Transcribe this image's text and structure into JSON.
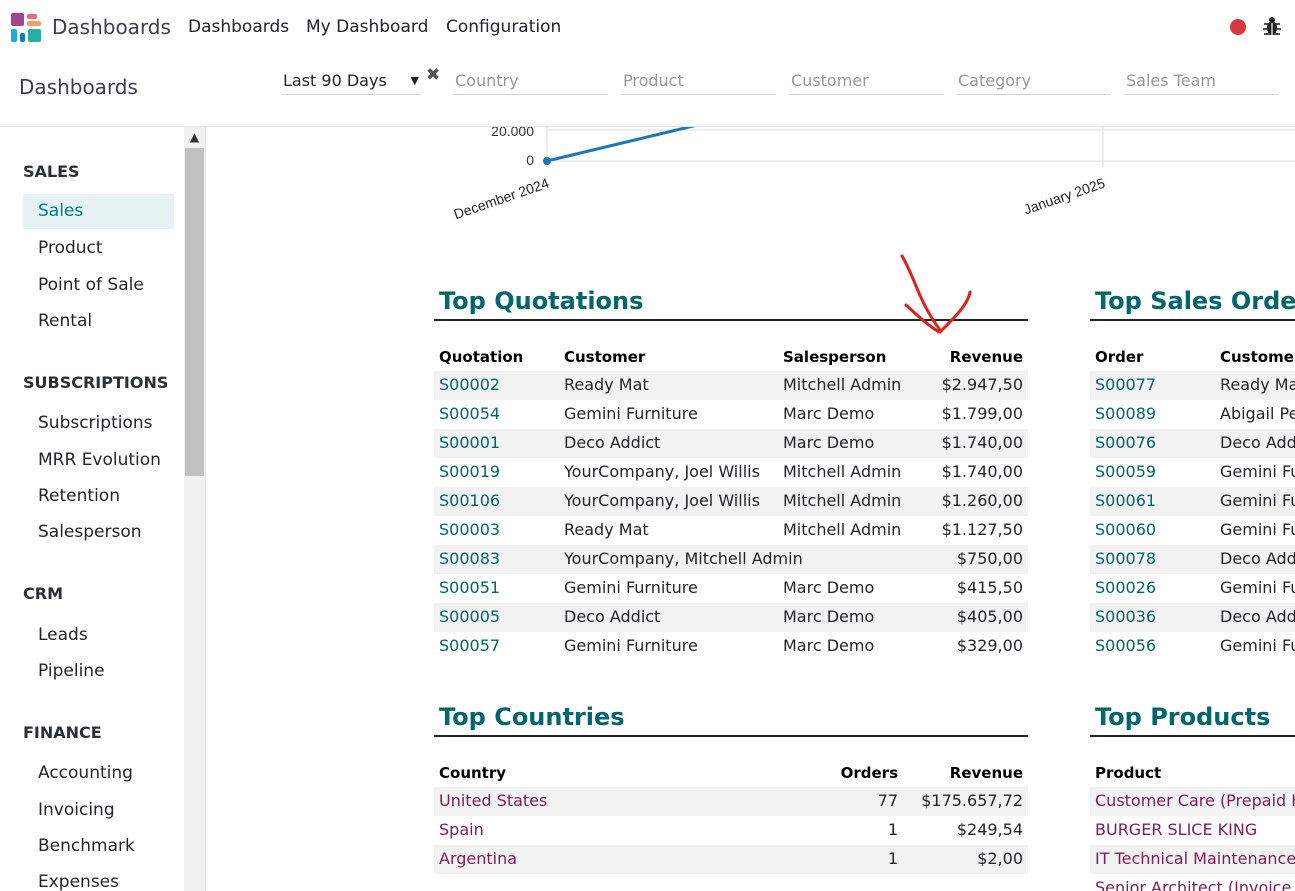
{
  "navbar": {
    "app_name": "Dashboards",
    "menu": [
      "Dashboards",
      "My Dashboard",
      "Configuration"
    ]
  },
  "control_panel": {
    "title": "Dashboards",
    "date_filter": "Last 90 Days",
    "filters": [
      "Country",
      "Product",
      "Customer",
      "Category",
      "Sales Team"
    ]
  },
  "sidebar": {
    "sections": [
      {
        "title": "SALES",
        "items": [
          "Sales",
          "Product",
          "Point of Sale",
          "Rental"
        ]
      },
      {
        "title": "SUBSCRIPTIONS",
        "items": [
          "Subscriptions",
          "MRR Evolution",
          "Retention",
          "Salesperson"
        ]
      },
      {
        "title": "CRM",
        "items": [
          "Leads",
          "Pipeline"
        ]
      },
      {
        "title": "FINANCE",
        "items": [
          "Accounting",
          "Invoicing",
          "Benchmark",
          "Expenses"
        ]
      }
    ],
    "active": "Sales"
  },
  "chart_data": {
    "type": "line",
    "x_ticks": [
      "December 2024",
      "January 2025"
    ],
    "y_ticks": [
      "20.000",
      "0"
    ],
    "points": [
      {
        "x": "December 2024",
        "y": 0
      }
    ],
    "color": "#1f77b4"
  },
  "top_quotations": {
    "title": "Top Quotations",
    "columns": [
      "Quotation",
      "Customer",
      "Salesperson",
      "Revenue"
    ],
    "rows": [
      [
        "S00002",
        "Ready Mat",
        "Mitchell Admin",
        "$2.947,50"
      ],
      [
        "S00054",
        "Gemini Furniture",
        "Marc Demo",
        "$1.799,00"
      ],
      [
        "S00001",
        "Deco Addict",
        "Marc Demo",
        "$1.740,00"
      ],
      [
        "S00019",
        "YourCompany, Joel Willis",
        "Mitchell Admin",
        "$1.740,00"
      ],
      [
        "S00106",
        "YourCompany, Joel Willis",
        "Mitchell Admin",
        "$1.260,00"
      ],
      [
        "S00003",
        "Ready Mat",
        "Mitchell Admin",
        "$1.127,50"
      ],
      [
        "S00083",
        "YourCompany, Mitchell Admin",
        "",
        "$750,00"
      ],
      [
        "S00051",
        "Gemini Furniture",
        "Marc Demo",
        "$415,50"
      ],
      [
        "S00005",
        "Deco Addict",
        "Marc Demo",
        "$405,00"
      ],
      [
        "S00057",
        "Gemini Furniture",
        "Marc Demo",
        "$329,00"
      ]
    ]
  },
  "top_sales_orders": {
    "title": "Top Sales Orders",
    "columns": [
      "Order",
      "Customer"
    ],
    "rows": [
      [
        "S00077",
        "Ready Mat"
      ],
      [
        "S00089",
        "Abigail Pet"
      ],
      [
        "S00076",
        "Deco Addi"
      ],
      [
        "S00059",
        "Gemini Fur"
      ],
      [
        "S00061",
        "Gemini Fur"
      ],
      [
        "S00060",
        "Gemini Fur"
      ],
      [
        "S00078",
        "Deco Addi"
      ],
      [
        "S00026",
        "Gemini Fur"
      ],
      [
        "S00036",
        "Deco Addi"
      ],
      [
        "S00056",
        "Gemini Fur"
      ]
    ]
  },
  "top_countries": {
    "title": "Top Countries",
    "columns": [
      "Country",
      "Orders",
      "Revenue"
    ],
    "rows": [
      [
        "United States",
        "77",
        "$175.657,72"
      ],
      [
        "Spain",
        "1",
        "$249,54"
      ],
      [
        "Argentina",
        "1",
        "$2,00"
      ]
    ]
  },
  "top_products": {
    "title": "Top Products",
    "columns": [
      "Product"
    ],
    "rows": [
      [
        "Customer Care (Prepaid Hou"
      ],
      [
        "BURGER SLICE KING"
      ],
      [
        "IT Technical Maintenance (P"
      ],
      [
        "Senior Architect (Invoice on"
      ]
    ]
  },
  "colors": {
    "accent": "#01666b",
    "product_link": "#7c1d58",
    "annotation": "#e0201a"
  }
}
